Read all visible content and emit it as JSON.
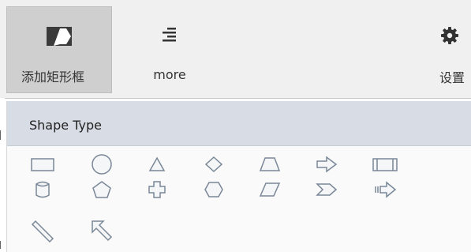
{
  "toolbar": {
    "add_rect_label": "添加矩形框",
    "more_label": "more",
    "settings_label": "设置"
  },
  "panel": {
    "title": "Shape Type",
    "shapes": [
      "rectangle",
      "ellipse",
      "triangle",
      "diamond",
      "trapezoid",
      "right-arrow",
      "process",
      "cylinder",
      "pentagon",
      "cross",
      "hexagon",
      "parallelogram",
      "chevron",
      "striped-arrow",
      "line",
      "pointer-arrow"
    ]
  },
  "colors": {
    "toolbar_bg": "#f0f0f0",
    "active_btn_bg": "#cfcfcf",
    "panel_header_bg": "#d8dde5",
    "shape_stroke": "#7a8797"
  }
}
